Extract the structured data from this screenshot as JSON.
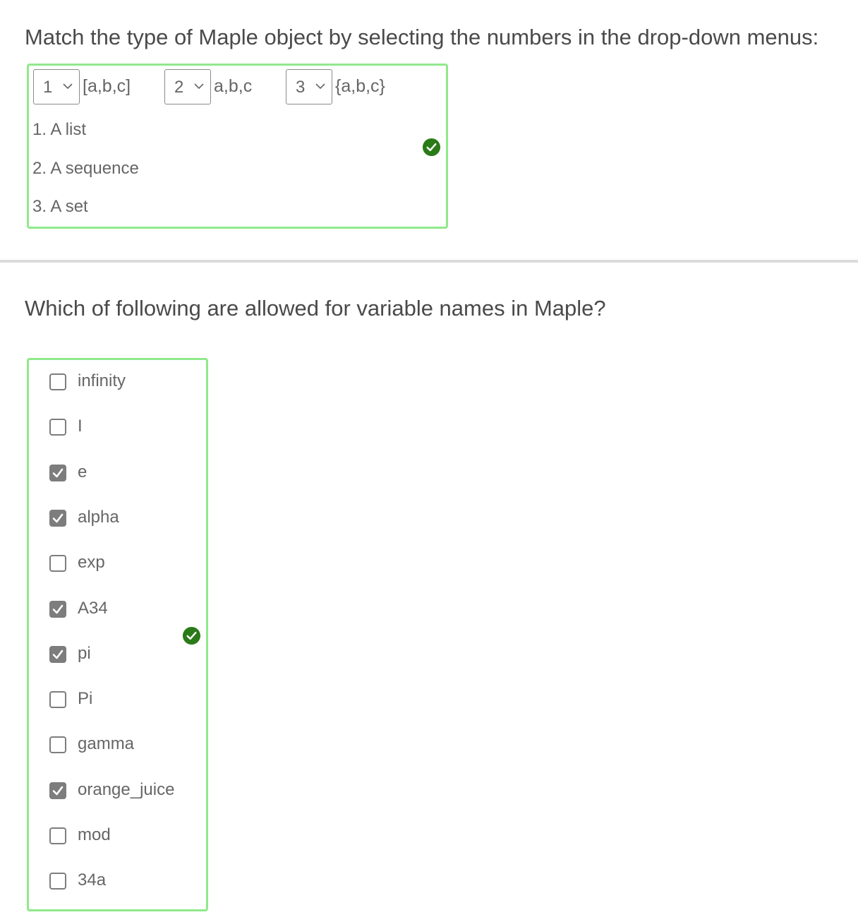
{
  "q1": {
    "title": "Match the type of Maple object by selecting the numbers in the drop-down menus:",
    "dropdowns": [
      {
        "value": "1",
        "expression": "[a,b,c]"
      },
      {
        "value": "2",
        "expression": "a,b,c"
      },
      {
        "value": "3",
        "expression": "{a,b,c}"
      }
    ],
    "options": [
      "1.  A list",
      "2.  A sequence",
      "3.  A set"
    ],
    "status_icon": "check-circle-icon",
    "status_color": "#2a7a18"
  },
  "q2": {
    "title": "Which of following are allowed for variable names in Maple?",
    "items": [
      {
        "label": "infinity",
        "checked": false
      },
      {
        "label": "I",
        "checked": false
      },
      {
        "label": "e",
        "checked": true
      },
      {
        "label": "alpha",
        "checked": true
      },
      {
        "label": "exp",
        "checked": false
      },
      {
        "label": "A34",
        "checked": true
      },
      {
        "label": "pi",
        "checked": true
      },
      {
        "label": "Pi",
        "checked": false
      },
      {
        "label": "gamma",
        "checked": false
      },
      {
        "label": "orange_juice",
        "checked": true
      },
      {
        "label": "mod",
        "checked": false
      },
      {
        "label": "34a",
        "checked": false
      }
    ],
    "status_icon": "check-circle-icon",
    "status_color": "#2a7a18"
  },
  "colors": {
    "correct_border": "#90e98a",
    "checkbox_checked": "#7d7d7d"
  }
}
